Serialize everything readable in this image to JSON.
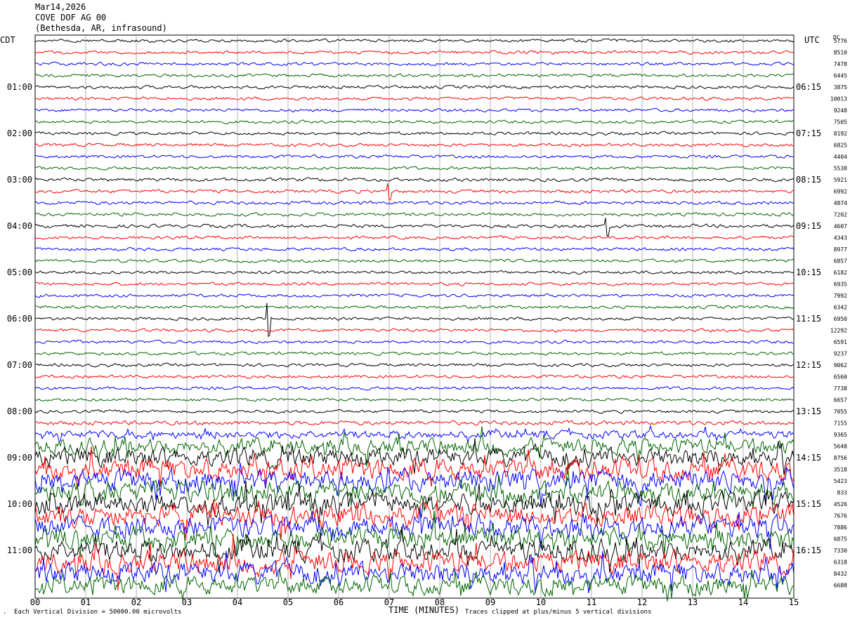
{
  "header": {
    "date": "Mar14,2026",
    "station": "COVE DOF AG 00",
    "location": "(Bethesda, AR, infrasound)"
  },
  "left_tz": "CDT",
  "right_tz": "UTC",
  "dc_label": "DC",
  "footer": {
    "vertical_division": "Each Vertical Division = 50000.00 microvolts",
    "xlabel": "TIME (MINUTES)",
    "clip_note": "Traces clipped at plus/minus 5 vertical divisions"
  },
  "colors": {
    "trace_cycle": [
      "#000000",
      "#ff0000",
      "#0000ff",
      "#006400"
    ],
    "grid": "#808080"
  },
  "chart_data": {
    "type": "line",
    "xlabel": "TIME (MINUTES)",
    "xlim": [
      0,
      15
    ],
    "x_ticks": [
      "00",
      "01",
      "02",
      "03",
      "04",
      "05",
      "06",
      "07",
      "08",
      "09",
      "10",
      "11",
      "12",
      "13",
      "14",
      "15"
    ],
    "left_hour_labels": [
      "01:00",
      "02:00",
      "03:00",
      "04:00",
      "05:00",
      "06:00",
      "07:00",
      "08:00",
      "09:00",
      "10:00",
      "11:00"
    ],
    "right_hour_labels": [
      "06:15",
      "07:15",
      "08:15",
      "09:15",
      "10:15",
      "11:15",
      "12:15",
      "13:15",
      "14:15",
      "15:15",
      "16:15"
    ],
    "trace_count": 48,
    "trace_interval_minutes": 15,
    "dc_offsets": [
      "5776",
      "8510",
      "7478",
      "6445",
      "3875",
      "10013",
      "9248",
      "7505",
      "8192",
      "6825",
      "4404",
      "5538",
      "5921",
      "6992",
      "4874",
      "7202",
      "4607",
      "4343",
      "8977",
      "6857",
      "6182",
      "6935",
      "7992",
      "6342",
      "6950",
      "12292",
      "6591",
      "9237",
      "9062",
      "6560",
      "7738",
      "6657",
      "7055",
      "7155",
      "9365",
      "5648",
      "8756",
      "3518",
      "5423",
      "833",
      "4526",
      "7676",
      "7886",
      "6875",
      "7330",
      "6318",
      "8432",
      "6688"
    ],
    "amplitude_scale": [
      1,
      1,
      1,
      1,
      1,
      1,
      1,
      1,
      1,
      1,
      1,
      1,
      1.1,
      1.1,
      1.1,
      1.1,
      1.1,
      1,
      1,
      1,
      1,
      1,
      1,
      1,
      1,
      1,
      1,
      1,
      1,
      1,
      1,
      1,
      1,
      1.4,
      2.5,
      5,
      6,
      7,
      7,
      7,
      7,
      7,
      7,
      7,
      7,
      7,
      7,
      6
    ],
    "events": [
      {
        "trace": 24,
        "minute": 4.6,
        "amplitude": 6,
        "note": "spike"
      },
      {
        "trace": 13,
        "minute": 7.0,
        "amplitude": 3,
        "note": "spike"
      },
      {
        "trace": 16,
        "minute": 11.3,
        "amplitude": 3,
        "note": "spike"
      }
    ]
  }
}
